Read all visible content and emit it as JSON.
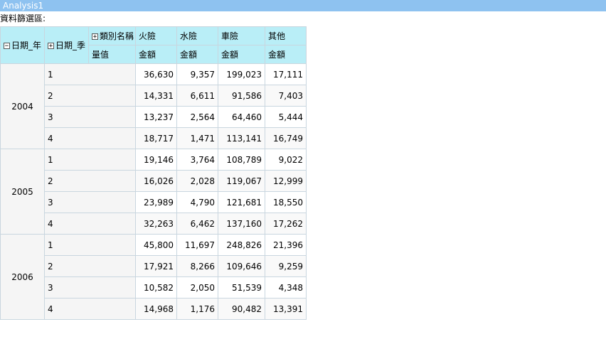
{
  "title": "Analysis1",
  "filter_area_label": "資料篩選區:",
  "headers": {
    "year_dim": "日期_年",
    "quarter_dim": "日期_季",
    "category_dim": "類別名稱",
    "measure_label": "量值",
    "columns": [
      {
        "name": "火險",
        "measure": "金額"
      },
      {
        "name": "水險",
        "measure": "金額"
      },
      {
        "name": "車險",
        "measure": "金額"
      },
      {
        "name": "其他",
        "measure": "金額"
      }
    ]
  },
  "rows": [
    {
      "year": "2004",
      "quarters": [
        {
          "q": "1",
          "values": [
            "36,630",
            "9,357",
            "199,023",
            "17,111"
          ]
        },
        {
          "q": "2",
          "values": [
            "14,331",
            "6,611",
            "91,586",
            "7,403"
          ]
        },
        {
          "q": "3",
          "values": [
            "13,237",
            "2,564",
            "64,460",
            "5,444"
          ]
        },
        {
          "q": "4",
          "values": [
            "18,717",
            "1,471",
            "113,141",
            "16,749"
          ]
        }
      ]
    },
    {
      "year": "2005",
      "quarters": [
        {
          "q": "1",
          "values": [
            "19,146",
            "3,764",
            "108,789",
            "9,022"
          ]
        },
        {
          "q": "2",
          "values": [
            "16,026",
            "2,028",
            "119,067",
            "12,999"
          ]
        },
        {
          "q": "3",
          "values": [
            "23,989",
            "4,790",
            "121,681",
            "18,550"
          ]
        },
        {
          "q": "4",
          "values": [
            "32,263",
            "6,462",
            "137,160",
            "17,262"
          ]
        }
      ]
    },
    {
      "year": "2006",
      "quarters": [
        {
          "q": "1",
          "values": [
            "45,800",
            "11,697",
            "248,826",
            "21,396"
          ]
        },
        {
          "q": "2",
          "values": [
            "17,921",
            "8,266",
            "109,646",
            "9,259"
          ]
        },
        {
          "q": "3",
          "values": [
            "10,582",
            "2,050",
            "51,539",
            "4,348"
          ]
        },
        {
          "q": "4",
          "values": [
            "14,968",
            "1,176",
            "90,482",
            "13,391"
          ]
        }
      ]
    }
  ]
}
